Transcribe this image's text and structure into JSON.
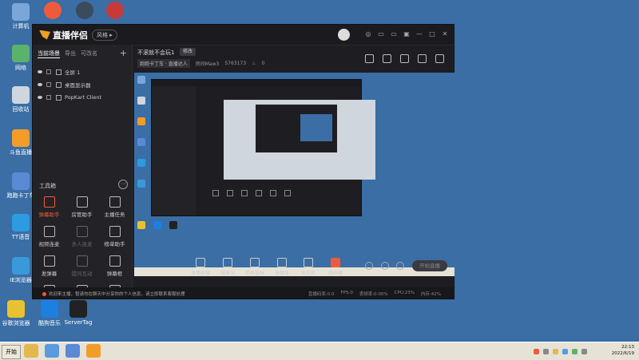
{
  "desktop_icons": [
    {
      "label": "计算机",
      "name": "computer-icon",
      "color": "#7aa7d8"
    },
    {
      "label": "网络",
      "name": "network-icon",
      "color": "#5bb36b"
    },
    {
      "label": "回收站",
      "name": "recycle-bin-icon",
      "color": "#cfd6dd"
    },
    {
      "label": "斗鱼直播",
      "name": "douyu-icon",
      "color": "#f39c2a"
    },
    {
      "label": "跑跑卡丁车",
      "name": "kart-icon",
      "color": "#5a8ad6"
    },
    {
      "label": "TT语音",
      "name": "tt-voice-icon",
      "color": "#2c9be0"
    },
    {
      "label": "IE浏览器",
      "name": "ie-browser-icon",
      "color": "#3a9ad9"
    },
    {
      "label": "谷歌浏览器",
      "name": "chrome-icon",
      "color": "#e8c230"
    },
    {
      "label": "酷狗音乐",
      "name": "kugou-icon",
      "color": "#1d7fe0"
    },
    {
      "label": "ServerTag",
      "name": "servertag-icon",
      "color": "#222"
    }
  ],
  "top_icons": [
    {
      "name": "qq-icon",
      "color": "#ef5a3c"
    },
    {
      "name": "tt-icon",
      "color": "#3b4b5c"
    },
    {
      "name": "game-icon",
      "color": "#c63a3a"
    }
  ],
  "window": {
    "app_name": "直播伴侣",
    "mode_chip": "风格 ▸",
    "titlebar_buttons": [
      "◎",
      "▭",
      "▭",
      "▣",
      "—",
      "□",
      "✕"
    ]
  },
  "left_panel": {
    "tabs": [
      "当前场景",
      "导出",
      "可改名"
    ],
    "plus": "+",
    "scenes": [
      "全屏 1",
      "桌面显示器",
      "PopKart Client"
    ],
    "tools_title": "工具箱",
    "tools_more": "⋯",
    "tools": [
      {
        "label": "弹幕助手",
        "state": "hot"
      },
      {
        "label": "房管助手",
        "state": "normal"
      },
      {
        "label": "主播任务",
        "state": "normal"
      },
      {
        "label": "视频连麦",
        "state": "normal"
      },
      {
        "label": "多人连麦",
        "state": "dim"
      },
      {
        "label": "榜单助手",
        "state": "normal"
      },
      {
        "label": "发弹幕",
        "state": "normal"
      },
      {
        "label": "提问互动",
        "state": "dim"
      },
      {
        "label": "弹幕框",
        "state": "normal"
      },
      {
        "label": "",
        "state": "normal"
      },
      {
        "label": "",
        "state": "normal"
      },
      {
        "label": "",
        "state": "normal"
      }
    ]
  },
  "room": {
    "title": "不滚就不会玩1",
    "edit": "修改",
    "category": "跑跑卡丁车 · 直播达人",
    "room_id": "房间Maw3",
    "id_number": "5763173",
    "heat": "0"
  },
  "bottom_toolbar": [
    {
      "label": "直播屏幕",
      "name": "screen-share-button"
    },
    {
      "label": "摄像头",
      "name": "camera-button"
    },
    {
      "label": "手机投屏",
      "name": "phone-cast-button"
    },
    {
      "label": "多媒体",
      "name": "media-button"
    },
    {
      "label": "麦克风",
      "name": "microphone-button"
    },
    {
      "label": "扬声器",
      "name": "speaker-button"
    }
  ],
  "live_button": "开始直播",
  "status": {
    "message": "欢迎来主播，暂请勿在聊天中分享你的个人信息，请立即联系客服处理",
    "stats": [
      "直播码率:0.0",
      "FPS:0",
      "丢帧率:0.00%",
      "CPU:23%",
      "内存:42%",
      ""
    ]
  },
  "taskbar": {
    "start": "开始",
    "apps": [
      {
        "name": "folder-icon",
        "color": "#e3b84d"
      },
      {
        "name": "browser-icon",
        "color": "#5a9be0"
      },
      {
        "name": "kart-task-icon",
        "color": "#5a8ad6"
      },
      {
        "name": "douyu-task-icon",
        "color": "#f39c2a"
      }
    ],
    "time": "22:13",
    "date": "2022/6/19"
  }
}
